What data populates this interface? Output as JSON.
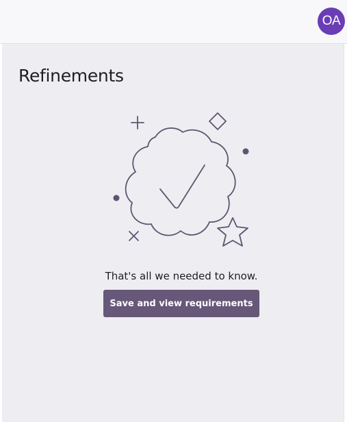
{
  "header": {
    "avatar_initials": "OA",
    "avatar_color": "#6a3db5"
  },
  "main": {
    "title": "Refinements",
    "illustration_icon": "checkmark-badge-illustration",
    "message": "That's all we needed to know.",
    "primary_button_label": "Save and view requirements",
    "accent_color": "#675778"
  }
}
